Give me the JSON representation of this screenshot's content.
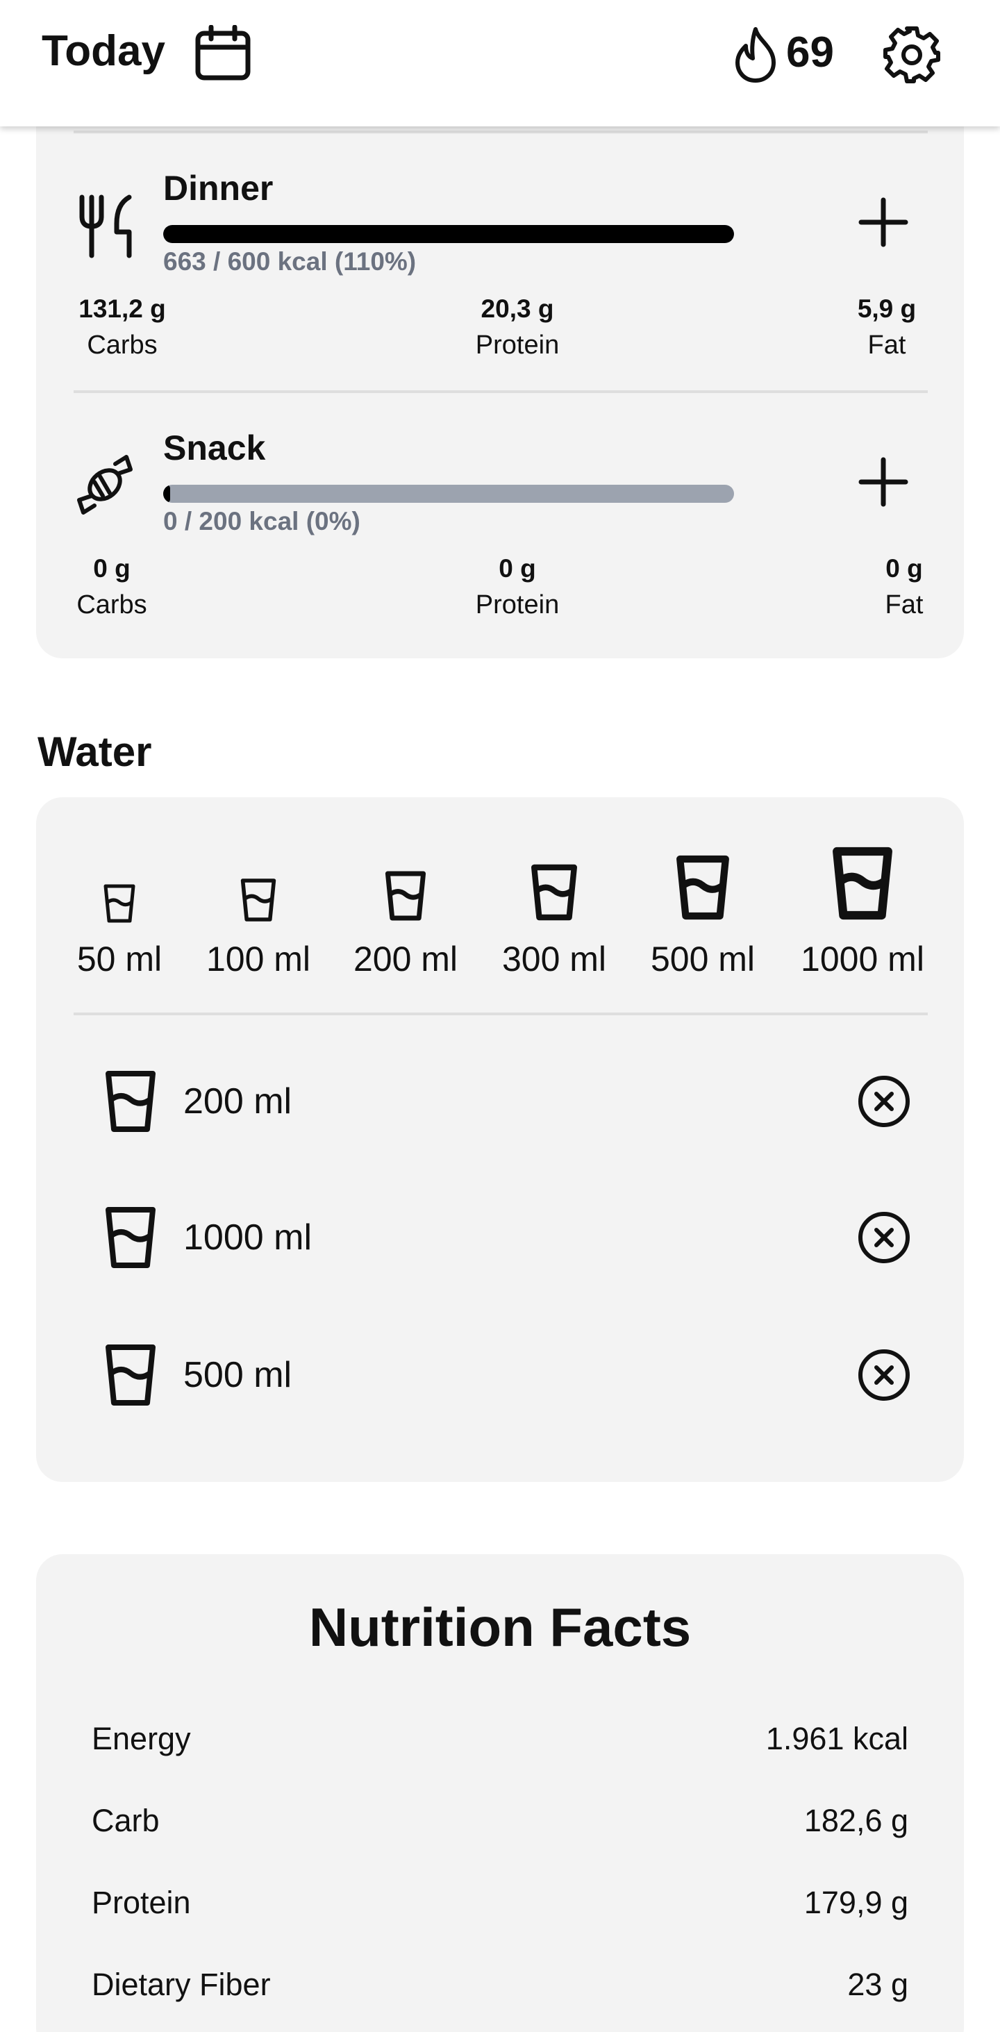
{
  "header": {
    "title": "Today",
    "calendar_icon": "calendar-icon",
    "streak_icon": "flame-icon",
    "streak_count": "69",
    "settings_icon": "gear-icon"
  },
  "meals": [
    {
      "name": "Dinner",
      "icon": "fork-knife-icon",
      "kcal_text": "663 / 600 kcal (110%)",
      "progress_percent": 100,
      "macros": [
        {
          "value": "131,2 g",
          "label": "Carbs"
        },
        {
          "value": "20,3 g",
          "label": "Protein"
        },
        {
          "value": "5,9 g",
          "label": "Fat"
        }
      ]
    },
    {
      "name": "Snack",
      "icon": "candy-icon",
      "kcal_text": "0 / 200 kcal (0%)",
      "progress_percent": 0,
      "macros": [
        {
          "value": "0 g",
          "label": "Carbs"
        },
        {
          "value": "0 g",
          "label": "Protein"
        },
        {
          "value": "0 g",
          "label": "Fat"
        }
      ]
    }
  ],
  "water": {
    "title": "Water",
    "options": [
      "50 ml",
      "100 ml",
      "200 ml",
      "300 ml",
      "500 ml",
      "1000 ml"
    ],
    "entries": [
      "200 ml",
      "1000 ml",
      "500 ml"
    ]
  },
  "nutrition": {
    "title": "Nutrition Facts",
    "rows": [
      {
        "label": "Energy",
        "value": "1.961 kcal"
      },
      {
        "label": "Carb",
        "value": "182,6 g"
      },
      {
        "label": "Protein",
        "value": "179,9 g"
      },
      {
        "label": "Dietary Fiber",
        "value": "23 g"
      }
    ]
  },
  "colors": {
    "card_bg": "#f3f3f3",
    "progress_fill": "#000000",
    "progress_track": "#9ca3af",
    "muted_text": "#6b7280"
  }
}
